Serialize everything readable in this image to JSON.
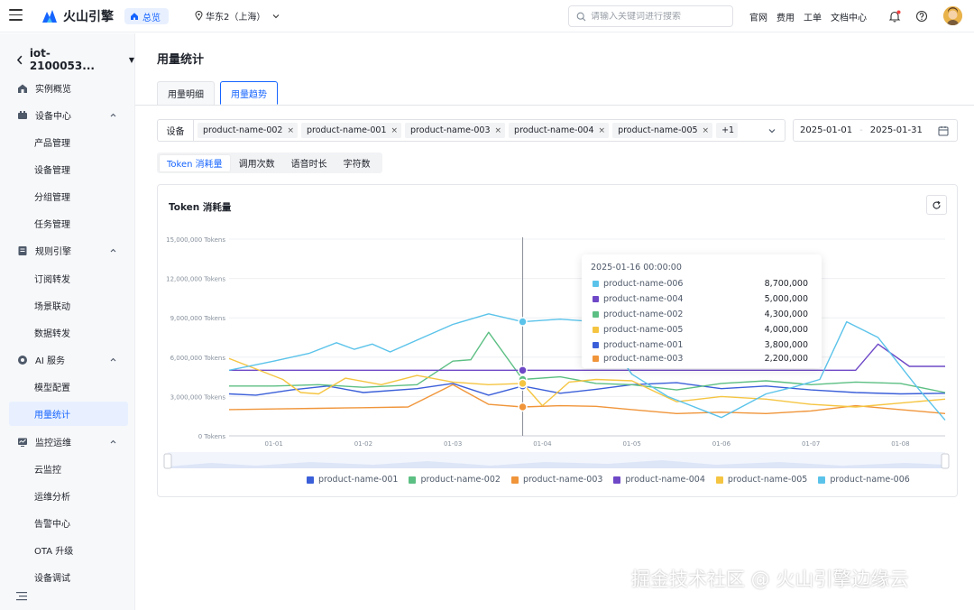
{
  "topbar": {
    "brand": "火山引擎",
    "home_pill": "总览",
    "region": "华东2（上海）",
    "search_placeholder": "请输入关键词进行搜索",
    "links": [
      "官网",
      "费用",
      "工单",
      "文档中心"
    ]
  },
  "sidebar": {
    "instance": "iot-2100053...",
    "groups": [
      {
        "label": "实例概览",
        "icon": "overview-icon"
      },
      {
        "label": "设备中心",
        "icon": "device-icon",
        "children": [
          "产品管理",
          "设备管理",
          "分组管理",
          "任务管理"
        ]
      },
      {
        "label": "规则引擎",
        "icon": "rule-icon",
        "children": [
          "订阅转发",
          "场景联动",
          "数据转发"
        ]
      },
      {
        "label": "AI 服务",
        "icon": "ai-icon",
        "children": [
          "模型配置",
          "用量统计"
        ]
      },
      {
        "label": "监控运维",
        "icon": "monitor-icon",
        "children": [
          "云监控",
          "运维分析",
          "告警中心",
          "OTA 升级",
          "设备调试"
        ]
      }
    ],
    "active": "用量统计"
  },
  "main": {
    "title": "用量统计",
    "tabs": [
      "用量明细",
      "用量趋势"
    ],
    "active_tab": "用量趋势",
    "filter_label": "设备",
    "chips": [
      "product-name-002",
      "product-name-001",
      "product-name-003",
      "product-name-004",
      "product-name-005"
    ],
    "more_chip": "+1",
    "date_start": "2025-01-01",
    "date_end": "2025-01-31",
    "metric_tabs": [
      "Token 消耗量",
      "调用次数",
      "语音时长",
      "字符数"
    ],
    "active_metric": "Token 消耗量",
    "card_title": "Token 消耗量"
  },
  "tooltip": {
    "title": "2025-01-16 00:00:00",
    "rows": [
      {
        "name": "product-name-006",
        "value": "8,700,000",
        "color": "#5bc3ea"
      },
      {
        "name": "product-name-004",
        "value": "5,000,000",
        "color": "#6e48c7"
      },
      {
        "name": "product-name-002",
        "value": "4,300,000",
        "color": "#5cbf83"
      },
      {
        "name": "product-name-005",
        "value": "4,000,000",
        "color": "#f5c542"
      },
      {
        "name": "product-name-001",
        "value": "3,800,000",
        "color": "#3b5fd9"
      },
      {
        "name": "product-name-003",
        "value": "2,200,000",
        "color": "#f0953a"
      }
    ]
  },
  "chart_data": {
    "type": "line",
    "title": "Token 消耗量",
    "ylim": [
      0,
      15000000
    ],
    "y_ticks": [
      "0 Tokens",
      "3,000,000 Tokens",
      "6,000,000 Tokens",
      "9,000,000 Tokens",
      "12,000,000 Tokens",
      "15,000,000 Tokens"
    ],
    "y_tick_values": [
      0,
      3000000,
      6000000,
      9000000,
      12000000,
      15000000
    ],
    "x_ticks": [
      "01-01",
      "01-02",
      "01-03",
      "01-04",
      "01-05",
      "01-06",
      "01-07",
      "01-08"
    ],
    "x_range": [
      0.5,
      8.5
    ],
    "hover_x": 3.78,
    "grid": "horizontal",
    "legend": "bottom",
    "series": [
      {
        "name": "product-name-001",
        "color": "#3b5fd9",
        "x": [
          0.5,
          0.8,
          1.2,
          1.6,
          2.0,
          2.6,
          3.0,
          3.4,
          3.78,
          4.2,
          4.6,
          5.0,
          5.5,
          6.0,
          6.5,
          7.0,
          7.5,
          8.0,
          8.5
        ],
        "y": [
          3200000,
          3100000,
          3500000,
          3800000,
          3300000,
          3600000,
          4000000,
          3100000,
          3800000,
          3250000,
          3550000,
          3900000,
          4050000,
          3600000,
          3800000,
          3500000,
          3300000,
          3200000,
          3250000
        ]
      },
      {
        "name": "product-name-002",
        "color": "#5cbf83",
        "x": [
          0.5,
          1.0,
          1.5,
          2.0,
          2.6,
          3.0,
          3.2,
          3.4,
          3.78,
          4.2,
          4.6,
          5.0,
          5.5,
          6.0,
          6.5,
          7.0,
          7.5,
          8.0,
          8.5
        ],
        "y": [
          3800000,
          3800000,
          3900000,
          3700000,
          3900000,
          5700000,
          5800000,
          7900000,
          4300000,
          4500000,
          4000000,
          3900000,
          3500000,
          4000000,
          4200000,
          3900000,
          4100000,
          4000000,
          3300000
        ]
      },
      {
        "name": "product-name-003",
        "color": "#f0953a",
        "x": [
          0.5,
          1.0,
          1.5,
          2.0,
          2.5,
          3.0,
          3.4,
          3.78,
          4.2,
          4.6,
          5.0,
          5.5,
          6.0,
          6.5,
          7.0,
          7.5,
          8.0,
          8.5
        ],
        "y": [
          2000000,
          2050000,
          2100000,
          2150000,
          2200000,
          3900000,
          2400000,
          2200000,
          2300000,
          2250000,
          2000000,
          1700000,
          1800000,
          1700000,
          1900000,
          2300000,
          2000000,
          1700000
        ]
      },
      {
        "name": "product-name-004",
        "color": "#6e48c7",
        "x": [
          0.5,
          1.0,
          2.0,
          3.0,
          3.78,
          4.2,
          5.0,
          6.0,
          7.0,
          7.5,
          7.75,
          8.1,
          8.5
        ],
        "y": [
          5000000,
          5000000,
          5000000,
          5000000,
          5000000,
          5000000,
          5000000,
          5000000,
          5000000,
          5000000,
          7000000,
          5300000,
          5300000
        ]
      },
      {
        "name": "product-name-005",
        "color": "#f5c542",
        "x": [
          0.5,
          0.8,
          1.1,
          1.3,
          1.5,
          1.8,
          2.2,
          2.6,
          3.0,
          3.4,
          3.78,
          4.0,
          4.3,
          4.6,
          5.0,
          5.5,
          6.0,
          6.5,
          7.0,
          7.5,
          8.0,
          8.5
        ],
        "y": [
          5900000,
          5100000,
          4300000,
          3300000,
          3200000,
          4400000,
          3900000,
          4600000,
          4100000,
          3900000,
          4000000,
          2300000,
          4100000,
          4300000,
          4200000,
          2600000,
          3000000,
          2800000,
          2400000,
          2200000,
          2500000,
          2800000
        ]
      },
      {
        "name": "product-name-006",
        "color": "#5bc3ea",
        "x": [
          0.5,
          1.0,
          1.4,
          1.7,
          1.9,
          2.1,
          2.3,
          2.7,
          3.0,
          3.4,
          3.78,
          4.2,
          4.6,
          5.0,
          5.4,
          6.0,
          6.5,
          6.8,
          7.1,
          7.4,
          7.75,
          8.2,
          8.5
        ],
        "y": [
          5000000,
          5700000,
          6300000,
          7100000,
          6600000,
          7000000,
          6400000,
          7600000,
          8500000,
          9300000,
          8700000,
          8900000,
          8700000,
          4700000,
          3000000,
          1400000,
          3200000,
          3700000,
          4300000,
          8700000,
          7500000,
          3600000,
          1200000
        ]
      }
    ]
  },
  "watermark": "掘金技术社区 @ 火山引擎边缘云"
}
